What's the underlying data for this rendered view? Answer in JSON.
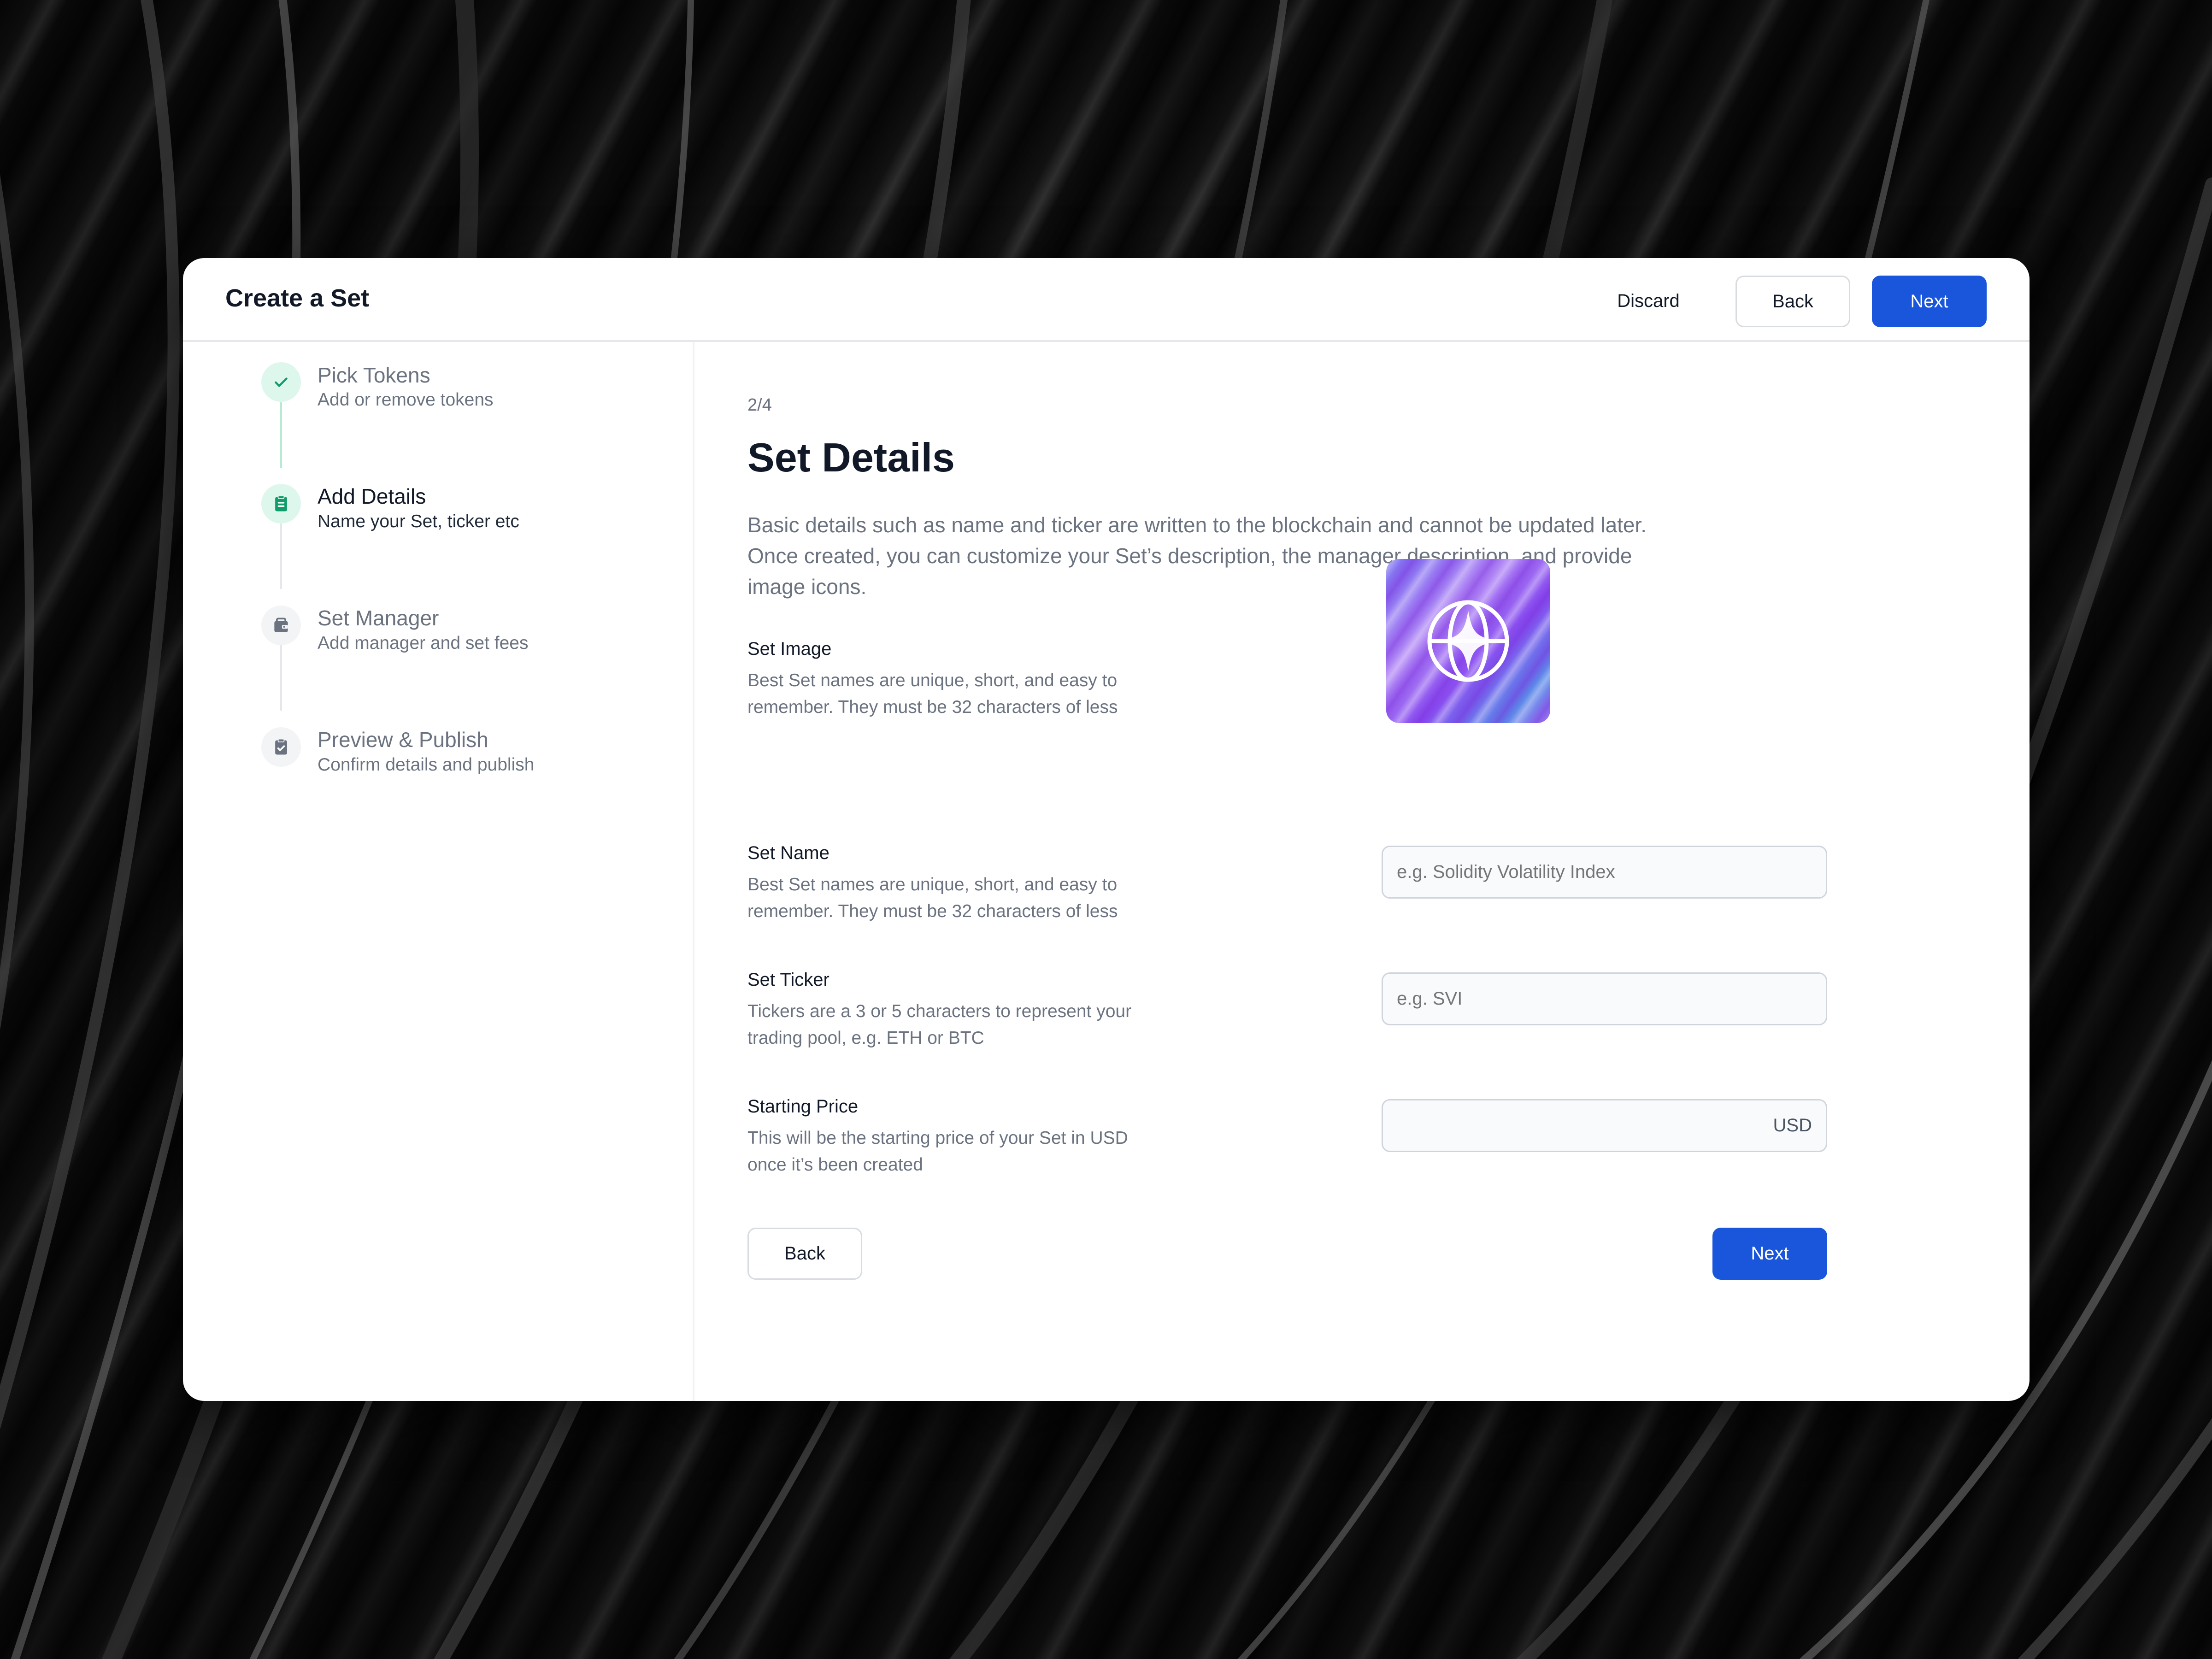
{
  "header": {
    "title": "Create a Set",
    "discard_label": "Discard",
    "back_label": "Back",
    "next_label": "Next"
  },
  "steps": [
    {
      "title": "Pick Tokens",
      "subtitle": "Add or remove tokens",
      "status": "complete",
      "icon": "check-icon"
    },
    {
      "title": "Add Details",
      "subtitle": "Name your Set, ticker etc",
      "status": "current",
      "icon": "clipboard-icon"
    },
    {
      "title": "Set Manager",
      "subtitle": "Add manager and set fees",
      "status": "upcoming",
      "icon": "wallet-icon"
    },
    {
      "title": "Preview & Publish",
      "subtitle": "Confirm details and publish",
      "status": "upcoming",
      "icon": "clipboard-check-icon"
    }
  ],
  "main": {
    "step_counter": "2/4",
    "title": "Set Details",
    "description": "Basic details such as name and ticker are written to the blockchain and cannot be updated later. Once created, you can customize your Set’s description, the manager description, and provide image icons."
  },
  "fields": {
    "image": {
      "label": "Set Image",
      "help": "Best Set names are unique, short, and easy to remember. They must be 32 characters of less",
      "icon": "globe-sparkle-icon"
    },
    "name": {
      "label": "Set Name",
      "help": "Best Set names are unique, short, and easy to remember. They must be 32 characters of less",
      "placeholder": "e.g. Solidity Volatility Index",
      "value": ""
    },
    "ticker": {
      "label": "Set Ticker",
      "help": "Tickers are a 3 or 5 characters to represent your trading pool, e.g. ETH or BTC",
      "placeholder": "e.g. SVI",
      "value": ""
    },
    "price": {
      "label": "Starting Price",
      "help": "This will be the starting price of your Set in USD once it’s been created",
      "value": "",
      "suffix": "USD"
    }
  },
  "footer": {
    "back_label": "Back",
    "next_label": "Next"
  },
  "colors": {
    "primary": "#1a56db",
    "success": "#0f9d6c",
    "success_bg": "#def7ec"
  }
}
